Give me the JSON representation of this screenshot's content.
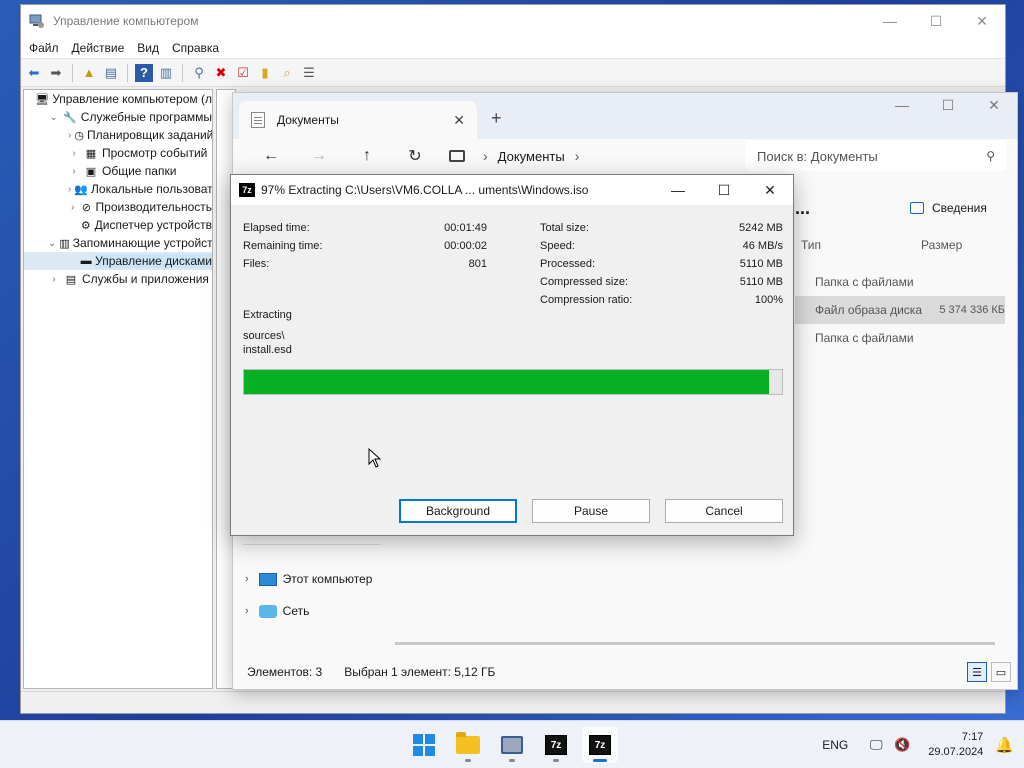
{
  "computer_management": {
    "title": "Управление компьютером",
    "menu": [
      "Файл",
      "Действие",
      "Вид",
      "Справка"
    ],
    "tree": [
      {
        "label": "Управление компьютером (л",
        "level": 0,
        "expander": "",
        "icon": "computer-management-icon"
      },
      {
        "label": "Служебные программы",
        "level": 1,
        "expander": "⌄",
        "icon": "tools-icon"
      },
      {
        "label": "Планировщик заданий",
        "level": 2,
        "expander": "›",
        "icon": "clock-icon"
      },
      {
        "label": "Просмотр событий",
        "level": 2,
        "expander": "›",
        "icon": "event-viewer-icon"
      },
      {
        "label": "Общие папки",
        "level": 2,
        "expander": "›",
        "icon": "shared-folder-icon"
      },
      {
        "label": "Локальные пользовате",
        "level": 2,
        "expander": "›",
        "icon": "users-icon"
      },
      {
        "label": "Производительность",
        "level": 2,
        "expander": "›",
        "icon": "performance-icon"
      },
      {
        "label": "Диспетчер устройств",
        "level": 2,
        "expander": "",
        "icon": "device-manager-icon"
      },
      {
        "label": "Запоминающие устройст",
        "level": 1,
        "expander": "⌄",
        "icon": "storage-icon"
      },
      {
        "label": "Управление дисками",
        "level": 2,
        "expander": "",
        "icon": "disk-icon",
        "selected": true
      },
      {
        "label": "Службы и приложения",
        "level": 1,
        "expander": "›",
        "icon": "services-icon"
      }
    ]
  },
  "explorer": {
    "tab_title": "Документы",
    "breadcrumb": "Документы",
    "search_placeholder": "Поиск в: Документы",
    "more_label": "...",
    "details_label": "Сведения",
    "columns": [
      "Тип",
      "Размер"
    ],
    "rows": [
      {
        "type": "Папка с файлами",
        "size": "",
        "selected": false
      },
      {
        "type": "Файл образа диска",
        "size": "5 374 336 КБ",
        "selected": true
      },
      {
        "type": "Папка с файлами",
        "size": "",
        "selected": false
      }
    ],
    "nav_tree": [
      {
        "label": "Этот компьютер",
        "icon": "this-pc-icon"
      },
      {
        "label": "Сеть",
        "icon": "network-icon"
      }
    ],
    "status_count": "Элементов: 3",
    "status_selection": "Выбран 1 элемент: 5,12 ГБ"
  },
  "sevenzip": {
    "title": "97% Extracting C:\\Users\\VM6.COLLA ... uments\\Windows.iso",
    "stats_left": [
      {
        "label": "Elapsed time:",
        "value": "00:01:49"
      },
      {
        "label": "Remaining time:",
        "value": "00:00:02"
      },
      {
        "label": "Files:",
        "value": "801"
      }
    ],
    "stats_right": [
      {
        "label": "Total size:",
        "value": "5242 MB"
      },
      {
        "label": "Speed:",
        "value": "46 MB/s"
      },
      {
        "label": "Processed:",
        "value": "5110 MB"
      },
      {
        "label": "Compressed size:",
        "value": "5110 MB"
      },
      {
        "label": "Compression ratio:",
        "value": "100%"
      }
    ],
    "operation": "Extracting",
    "current_folder": "sources\\",
    "current_file": "install.esd",
    "progress_fraction": 0.975,
    "progress_color": "#06b025",
    "buttons": {
      "background": "Background",
      "pause": "Pause",
      "cancel": "Cancel"
    }
  },
  "taskbar": {
    "language": "ENG",
    "time": "7:17",
    "date": "29.07.2024"
  }
}
